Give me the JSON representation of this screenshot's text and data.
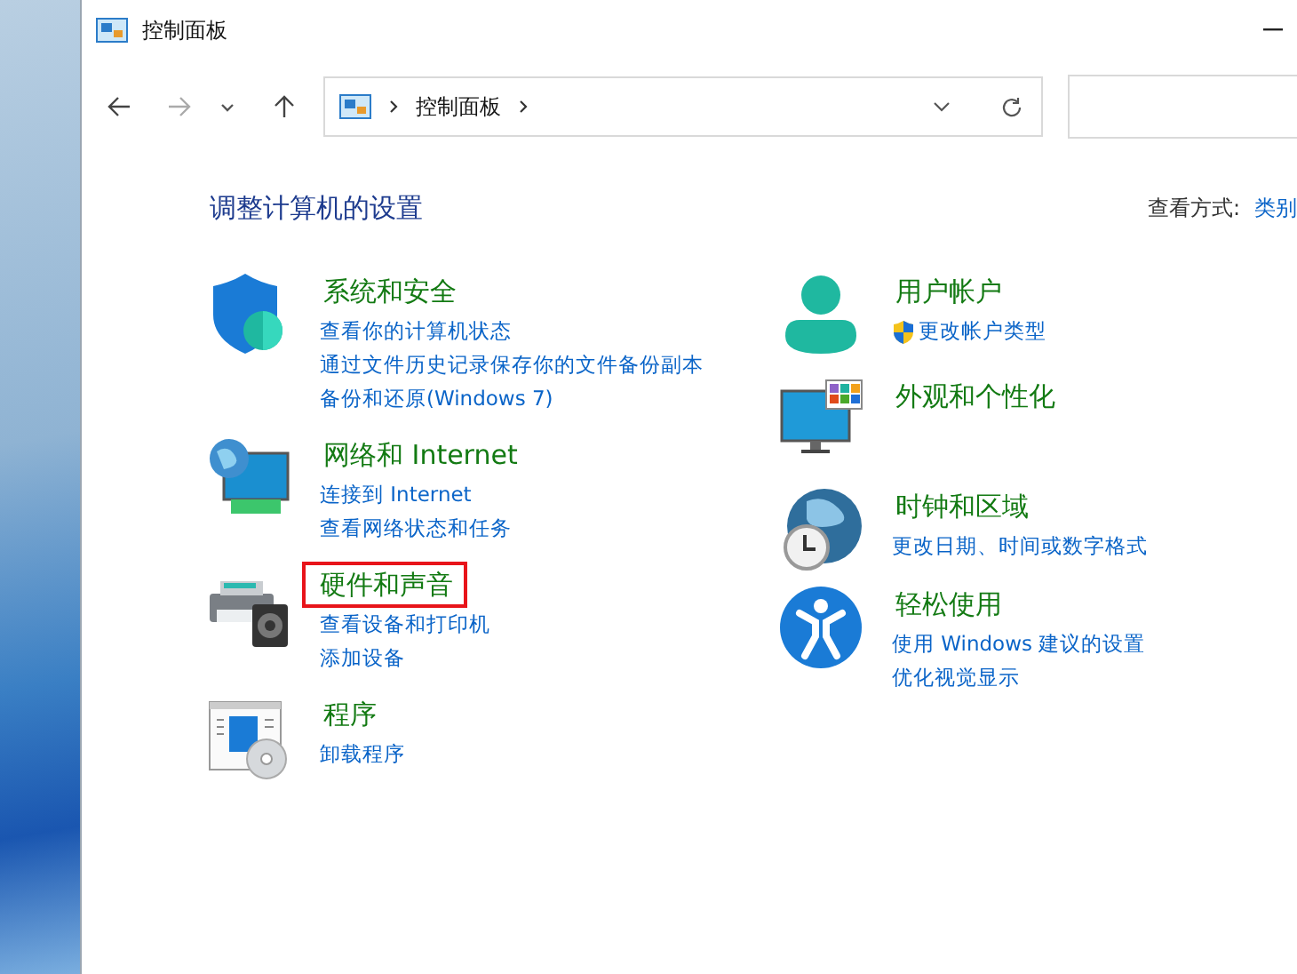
{
  "window": {
    "title": "控制面板"
  },
  "address_bar": {
    "crumbs": [
      "控制面板"
    ]
  },
  "heading": "调整计算机的设置",
  "view_by": {
    "label": "查看方式:",
    "value": "类别"
  },
  "columns": [
    {
      "categories": [
        {
          "title": "系统和安全",
          "highlighted": false,
          "links": [
            {
              "text": "查看你的计算机状态",
              "uac_shield": false
            },
            {
              "text": "通过文件历史记录保存你的文件备份副本",
              "uac_shield": false
            },
            {
              "text": "备份和还原(Windows 7)",
              "uac_shield": false
            }
          ]
        },
        {
          "title": "网络和 Internet",
          "highlighted": false,
          "links": [
            {
              "text": "连接到 Internet",
              "uac_shield": false
            },
            {
              "text": "查看网络状态和任务",
              "uac_shield": false
            }
          ]
        },
        {
          "title": "硬件和声音",
          "highlighted": true,
          "links": [
            {
              "text": "查看设备和打印机",
              "uac_shield": false
            },
            {
              "text": "添加设备",
              "uac_shield": false
            }
          ]
        },
        {
          "title": "程序",
          "highlighted": false,
          "links": [
            {
              "text": "卸载程序",
              "uac_shield": false
            }
          ]
        }
      ]
    },
    {
      "categories": [
        {
          "title": "用户帐户",
          "highlighted": false,
          "links": [
            {
              "text": "更改帐户类型",
              "uac_shield": true
            }
          ]
        },
        {
          "title": "外观和个性化",
          "highlighted": false
        },
        {
          "title": "时钟和区域",
          "highlighted": false,
          "links": [
            {
              "text": "更改日期、时间或数字格式",
              "uac_shield": false
            }
          ]
        },
        {
          "title": "轻松使用",
          "highlighted": false,
          "links": [
            {
              "text": "使用 Windows 建议的设置",
              "uac_shield": false
            },
            {
              "text": "优化视觉显示",
              "uac_shield": false
            }
          ]
        }
      ]
    }
  ]
}
